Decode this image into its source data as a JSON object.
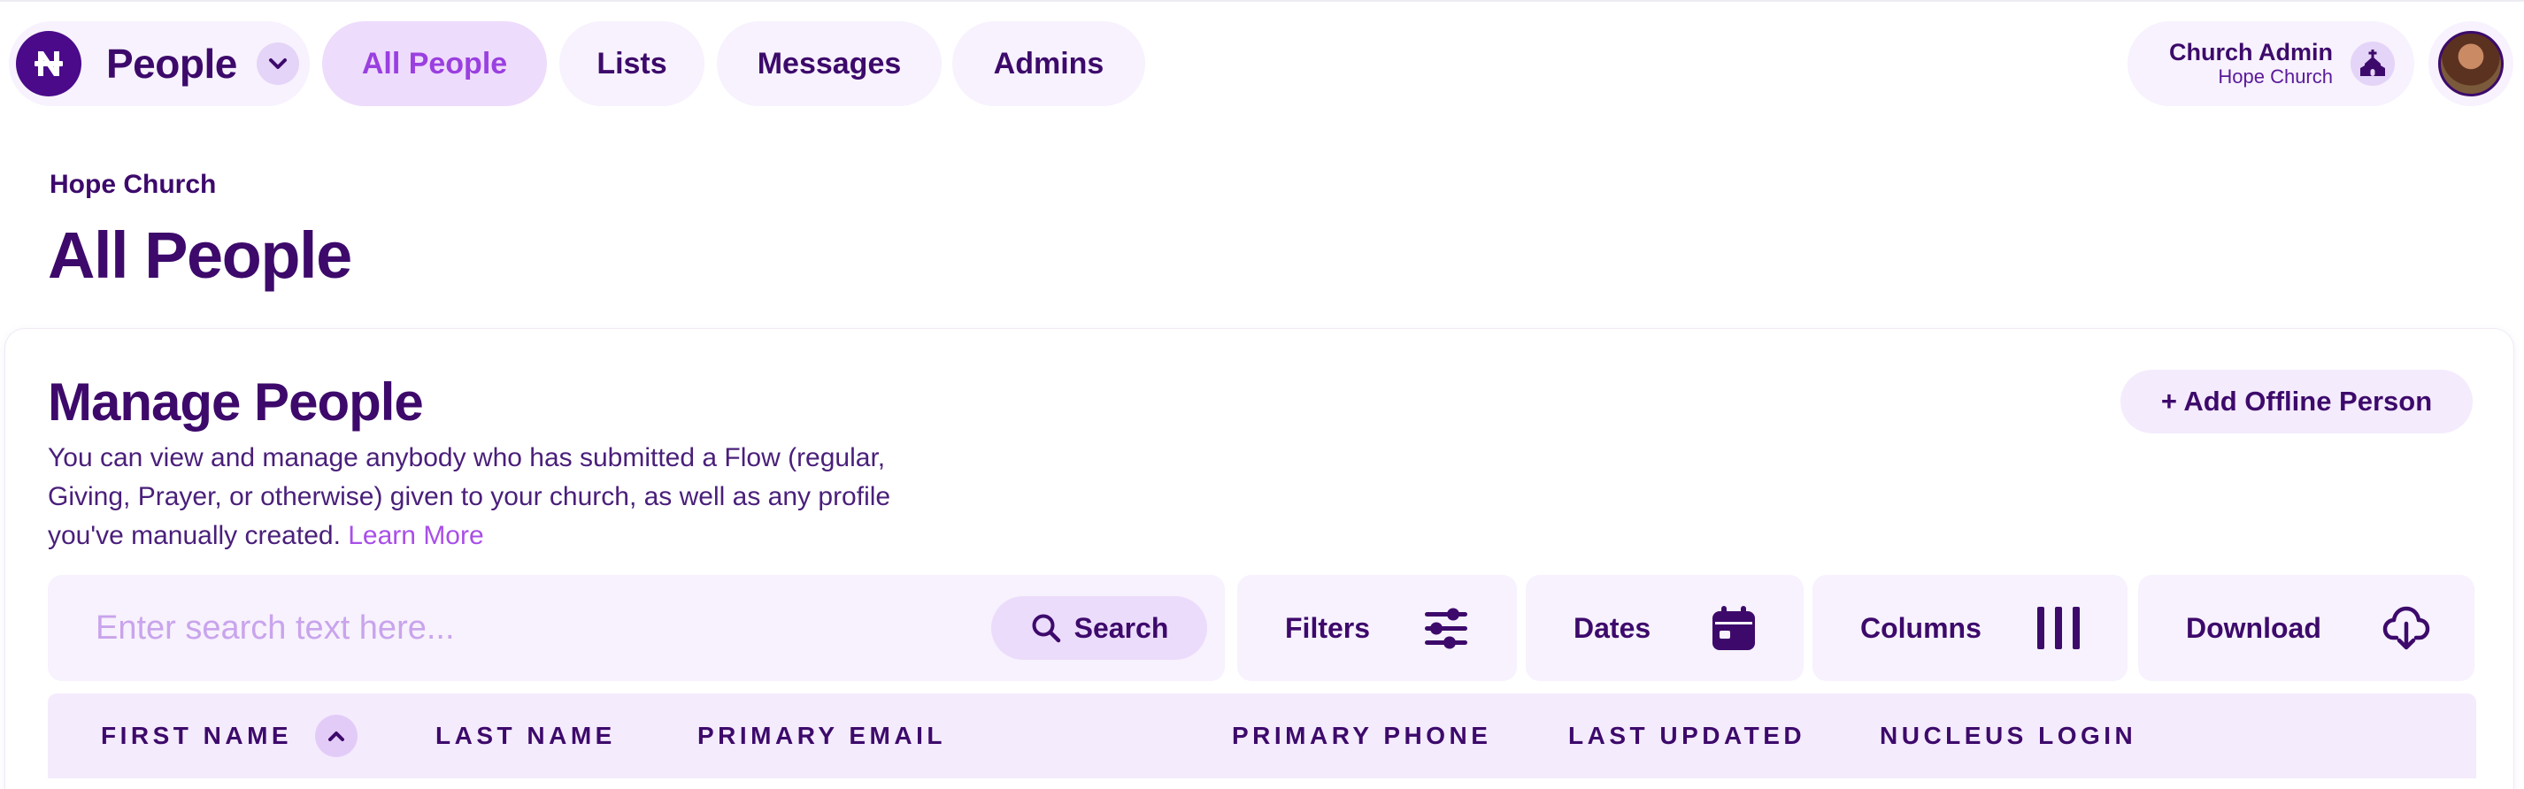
{
  "nav": {
    "app_name": "People",
    "tabs": [
      {
        "label": "All People",
        "active": true
      },
      {
        "label": "Lists",
        "active": false
      },
      {
        "label": "Messages",
        "active": false
      },
      {
        "label": "Admins",
        "active": false
      }
    ]
  },
  "account": {
    "role": "Church Admin",
    "organization": "Hope Church"
  },
  "header": {
    "breadcrumb": "Hope Church",
    "title": "All People"
  },
  "card": {
    "title": "Manage People",
    "description": "You can view and manage anybody who has submitted a Flow (regular, Giving, Prayer, or otherwise) given to your church, as well as any profile you've manually created.",
    "learn_more": "Learn More",
    "add_button": "+ Add Offline Person"
  },
  "toolbar": {
    "search_placeholder": "Enter search text here...",
    "search_value": "",
    "search_button": "Search",
    "filters": "Filters",
    "dates": "Dates",
    "columns": "Columns",
    "download": "Download"
  },
  "table": {
    "columns": [
      "FIRST NAME",
      "LAST NAME",
      "PRIMARY EMAIL",
      "PRIMARY PHONE",
      "LAST UPDATED",
      "NUCLEUS LOGIN"
    ],
    "sorted_column": "FIRST NAME",
    "sort_direction": "ascending"
  },
  "colors": {
    "primary": "#3d0a6b",
    "accent": "#9a3fe0",
    "link": "#a84fe8",
    "pill_bg": "#f7f2fd",
    "active_pill_bg": "#eedcfc"
  },
  "icons": {
    "logo": "nucleus-logo-icon",
    "app_switch": "chevron-down-icon",
    "church": "church-icon",
    "search": "search-icon",
    "filters": "sliders-icon",
    "dates": "calendar-icon",
    "columns": "columns-icon",
    "download": "cloud-download-icon",
    "sort": "chevron-up-icon"
  }
}
